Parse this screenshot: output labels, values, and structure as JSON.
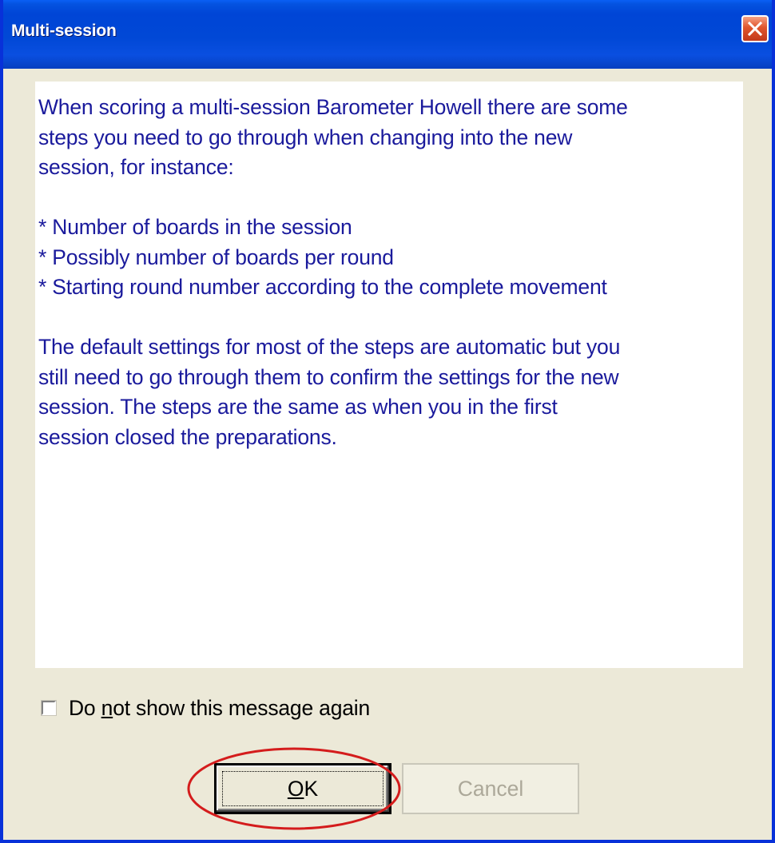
{
  "window": {
    "title": "Multi-session"
  },
  "message": {
    "text": "When scoring a multi-session Barometer Howell there are some\nsteps you need to go through when changing into the new\nsession, for instance:\n\n* Number of boards in the session\n* Possibly number of boards per round\n* Starting round number according to the complete movement\n\nThe default settings for most of the steps are automatic but you\nstill need to go through them to confirm the settings for the new\nsession. The steps are the same as when you in the first\nsession closed the preparations."
  },
  "checkbox": {
    "label_pre": "Do ",
    "label_mnemonic": "n",
    "label_post": "ot show this message again",
    "checked": false
  },
  "buttons": {
    "ok_mnemonic": "O",
    "ok_rest": "K",
    "cancel_label": "Cancel"
  },
  "colors": {
    "message_text": "#1a1a9c",
    "title_bar": "#0148d6",
    "annotation": "#d41c1c"
  },
  "icons": {
    "close": "close-icon"
  }
}
